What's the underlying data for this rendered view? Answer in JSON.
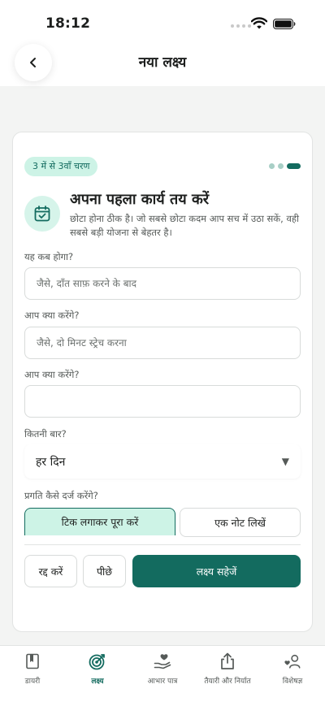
{
  "status_bar": {
    "time": "18:12"
  },
  "header": {
    "title": "नया लक्ष्य"
  },
  "card": {
    "step_label": "3 में से 3वाँ चरण",
    "step_total": 3,
    "step_current": 3,
    "title": "अपना पहला कार्य तय करें",
    "description": "छोटा होना ठीक है। जो सबसे छोटा कदम आप सच में उठा सकें, वही सबसे बड़ी योजना से बेहतर है।",
    "fields": [
      {
        "label": "यह कब होगा?",
        "value": "",
        "placeholder": "जैसे, दाँत साफ़ करने के बाद"
      },
      {
        "label": "आप क्या करेंगे?",
        "value": "",
        "placeholder": "जैसे, दो मिनट स्ट्रेच करना"
      },
      {
        "label": "आप क्या करेंगे?",
        "value": "",
        "placeholder": ""
      }
    ],
    "frequency": {
      "label": "कितनी बार?",
      "value": "हर दिन"
    },
    "progress": {
      "label": "प्रगति कैसे दर्ज करेंगे?",
      "options": [
        "टिक लगाकर पूरा करें",
        "एक नोट लिखें"
      ],
      "selected": 0
    },
    "actions": {
      "cancel": "रद्द करें",
      "back": "पीछे",
      "save": "लक्ष्य सहेजें"
    }
  },
  "tabs": [
    {
      "label": "डायरी",
      "icon": "book-icon"
    },
    {
      "label": "लक्ष्य",
      "icon": "target-icon",
      "active": true
    },
    {
      "label": "आभार पात्र",
      "icon": "heart-hand-icon"
    },
    {
      "label": "तैयारी और निर्यात",
      "icon": "share-upload-icon"
    },
    {
      "label": "विशेषज्ञ",
      "icon": "expert-icon"
    }
  ],
  "colors": {
    "accent": "#136b5f",
    "accent_light": "#cdf3e6",
    "background": "#f3f4f3"
  }
}
